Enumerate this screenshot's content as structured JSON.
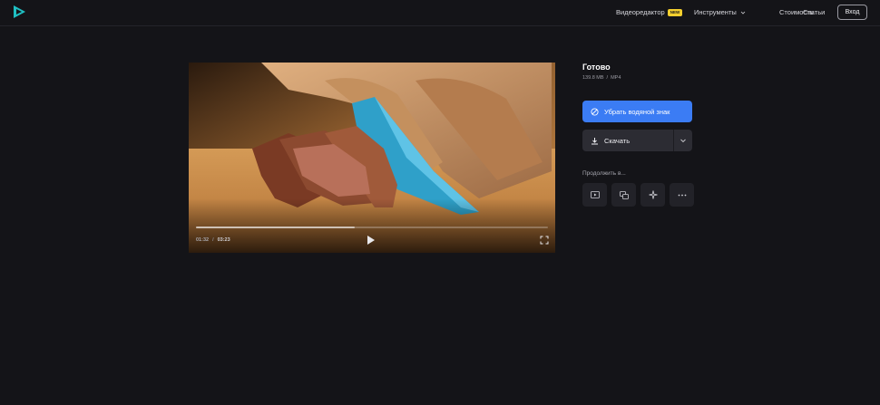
{
  "header": {
    "logo": "play-logo-icon",
    "nav": {
      "editor_label": "Видеоредактор",
      "editor_badge": "NEW",
      "tools_label": "Инструменты",
      "pricing_label": "Стоимость",
      "articles_label": "Статьи"
    },
    "login_label": "Вход"
  },
  "player": {
    "current_time": "01:32",
    "separator": "/",
    "duration": "03:23",
    "progress": 0.45,
    "play_icon": "play-icon",
    "fullscreen_icon": "fullscreen-icon"
  },
  "panel": {
    "status_title": "Готово",
    "file_size": "139.8 MB",
    "meta_separator": "/",
    "file_format": "MP4",
    "remove_watermark_label": "Убрать водяной знак",
    "download_label": "Скачать",
    "continue_label": "Продолжить в...",
    "tools": [
      "video-player-icon",
      "duplicate-icon",
      "sparkle-icon",
      "more-dots-icon"
    ]
  },
  "colors": {
    "background": "#141418",
    "accent": "#3b7cf4",
    "badge": "#f4cf2e"
  }
}
